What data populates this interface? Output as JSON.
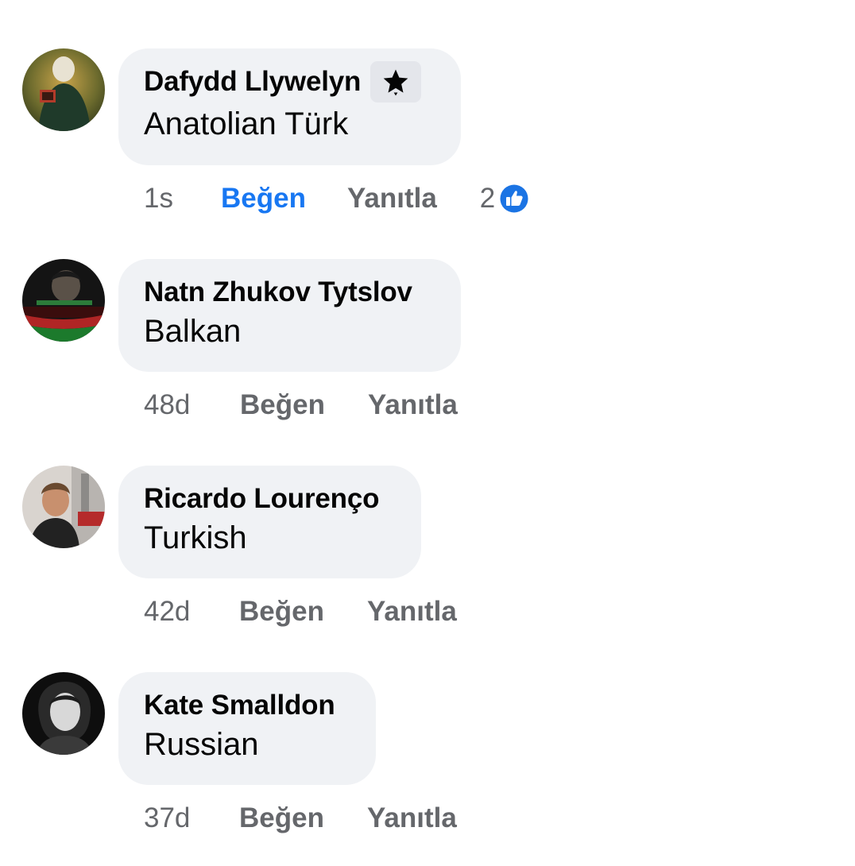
{
  "comments": [
    {
      "author": "Dafydd Llywelyn",
      "has_badge": true,
      "badge_icon": "star-icon",
      "text": "Anatolian Türk",
      "time": "1s",
      "like_label": "Beğen",
      "like_active": true,
      "reply_label": "Yanıtla",
      "reaction_count": "2"
    },
    {
      "author": "Natn Zhukov Tytslov",
      "text": "Balkan",
      "time": "48d",
      "like_label": "Beğen",
      "reply_label": "Yanıtla"
    },
    {
      "author": "Ricardo Lourenço",
      "text": "Turkish",
      "time": "42d",
      "like_label": "Beğen",
      "reply_label": "Yanıtla"
    },
    {
      "author": "Kate Smalldon",
      "text": "Russian",
      "time": "37d",
      "like_label": "Beğen",
      "reply_label": "Yanıtla"
    }
  ],
  "colors": {
    "bubble_bg": "#f0f2f5",
    "link_active": "#1877f2",
    "meta_text": "#65676b"
  }
}
